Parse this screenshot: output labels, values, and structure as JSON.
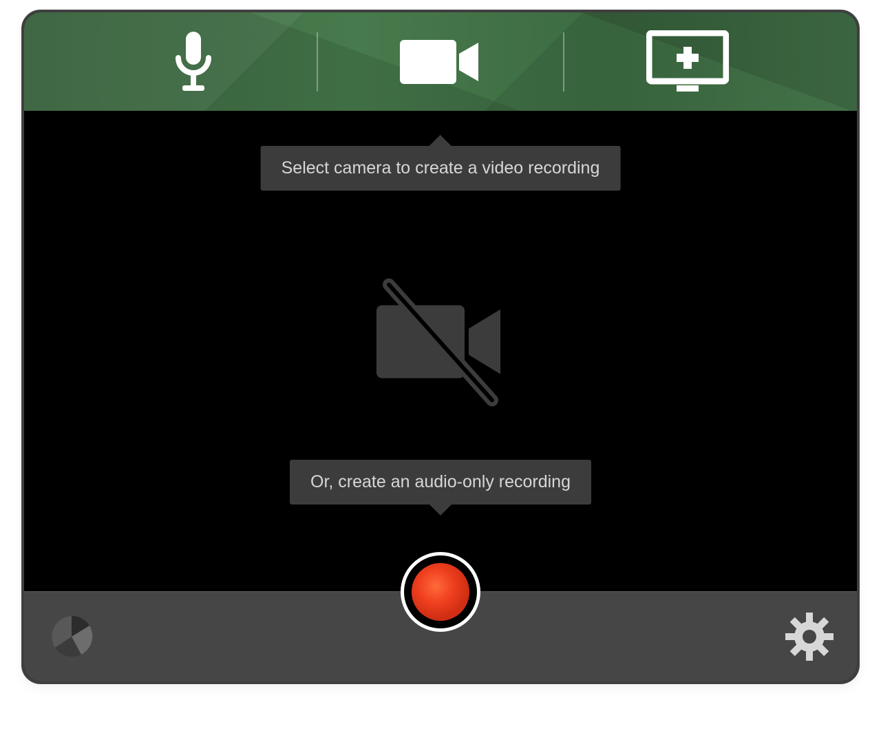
{
  "topbar": {
    "tabs": [
      {
        "name": "audio",
        "icon": "microphone-icon"
      },
      {
        "name": "video",
        "icon": "video-camera-icon"
      },
      {
        "name": "screen",
        "icon": "add-screen-icon"
      }
    ]
  },
  "tooltips": {
    "select_camera": "Select camera to create a video recording",
    "audio_only": "Or, create an audio-only recording"
  },
  "bottombar": {
    "logo_icon": "panopto-logo-icon",
    "settings_icon": "gear-icon"
  },
  "record_button": {
    "icon": "record-icon",
    "state": "idle"
  },
  "main_placeholder": {
    "icon": "video-camera-off-icon"
  }
}
